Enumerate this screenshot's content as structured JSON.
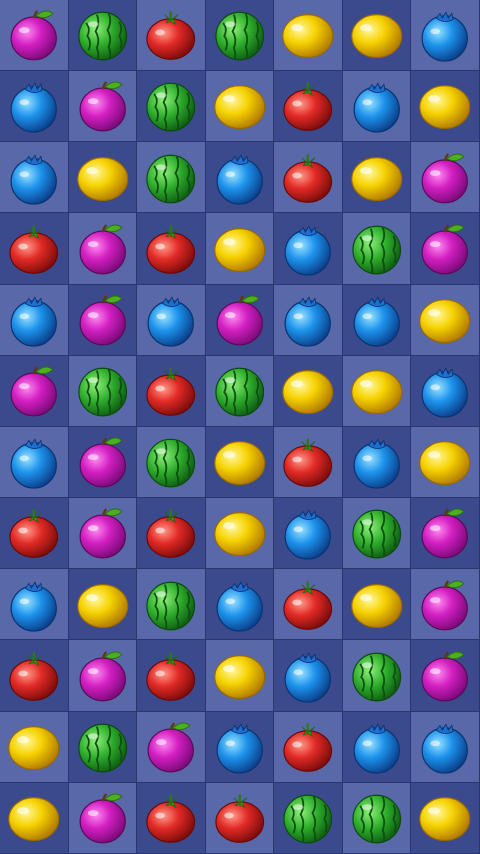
{
  "board": {
    "columns": 7,
    "rows": 12,
    "grid": [
      [
        "plum",
        "watermelon",
        "tomato",
        "watermelon",
        "lemon",
        "lemon",
        "blueberry"
      ],
      [
        "blueberry",
        "plum",
        "watermelon",
        "lemon",
        "tomato",
        "blueberry",
        "lemon"
      ],
      [
        "blueberry",
        "lemon",
        "watermelon",
        "blueberry",
        "tomato",
        "lemon",
        "plum"
      ],
      [
        "tomato",
        "plum",
        "tomato",
        "lemon",
        "blueberry",
        "watermelon",
        "plum"
      ],
      [
        "blueberry",
        "plum",
        "blueberry",
        "plum",
        "blueberry",
        "blueberry",
        "lemon"
      ],
      [
        "plum",
        "watermelon",
        "tomato",
        "watermelon",
        "lemon",
        "lemon",
        "blueberry"
      ],
      [
        "blueberry",
        "plum",
        "watermelon",
        "lemon",
        "tomato",
        "blueberry",
        "lemon"
      ],
      [
        "tomato",
        "plum",
        "tomato",
        "lemon",
        "blueberry",
        "watermelon",
        "plum"
      ],
      [
        "blueberry",
        "lemon",
        "watermelon",
        "blueberry",
        "tomato",
        "lemon",
        "plum"
      ],
      [
        "tomato",
        "plum",
        "tomato",
        "lemon",
        "blueberry",
        "watermelon",
        "plum"
      ],
      [
        "lemon",
        "watermelon",
        "plum",
        "blueberry",
        "tomato",
        "blueberry",
        "blueberry"
      ],
      [
        "lemon",
        "plum",
        "tomato",
        "tomato",
        "watermelon",
        "watermelon",
        "lemon"
      ]
    ]
  },
  "icons": {
    "plum": "plum-icon",
    "watermelon": "watermelon-icon",
    "tomato": "tomato-icon",
    "lemon": "lemon-icon",
    "blueberry": "blueberry-icon"
  },
  "colors": {
    "cell_light": "#5868a8",
    "cell_dark": "#3b4a8c",
    "plum": "#d31fc2",
    "watermelon": "#2fae2c",
    "tomato": "#e22a26",
    "lemon": "#f6d200",
    "blueberry": "#1d93ec"
  }
}
